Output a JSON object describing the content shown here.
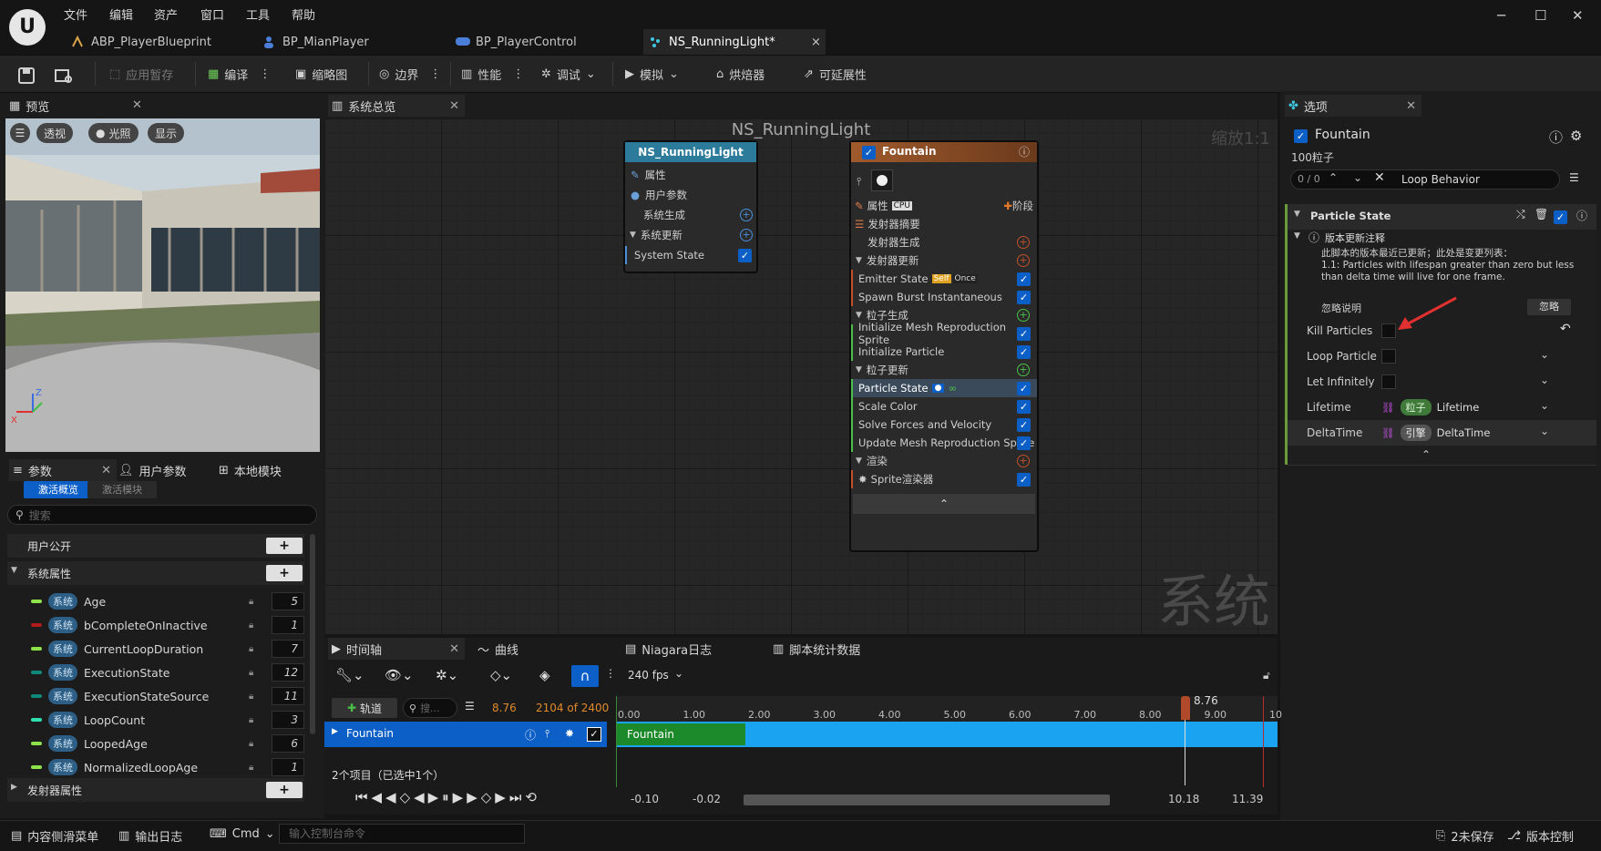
{
  "menu": [
    "文件",
    "编辑",
    "资产",
    "窗口",
    "工具",
    "帮助"
  ],
  "doc_tabs": [
    {
      "label": "ABP_PlayerBlueprint"
    },
    {
      "label": "BP_MianPlayer"
    },
    {
      "label": "BP_PlayerControl"
    },
    {
      "label": "NS_RunningLight*",
      "close": "×"
    }
  ],
  "toolbar": {
    "apply_pending": "应用暂存",
    "compile": "编译",
    "thumbnail": "缩略图",
    "bounds": "边界",
    "performance": "性能",
    "debug": "调试",
    "simulate": "模拟",
    "baker": "烘焙器",
    "scalability": "可延展性"
  },
  "preview": {
    "tab": "预览",
    "perspective": "透视",
    "lit": "光照",
    "show": "显示"
  },
  "params": {
    "tabs": [
      "参数",
      "用户参数",
      "本地模块"
    ],
    "subtabs": [
      "激活概览",
      "激活模块"
    ],
    "search_placeholder": "搜索",
    "user_exposed": "用户公开",
    "system_attrs": "系统属性",
    "emitter_attrs": "发射器属性",
    "badge": "系统",
    "rows": [
      {
        "name": "Age",
        "value": "5",
        "color": "#8ee24a"
      },
      {
        "name": "bCompleteOnInactive",
        "value": "1",
        "color": "#b11b1b"
      },
      {
        "name": "CurrentLoopDuration",
        "value": "7",
        "color": "#8ee24a"
      },
      {
        "name": "ExecutionState",
        "value": "12",
        "color": "#0f8a7a"
      },
      {
        "name": "ExecutionStateSource",
        "value": "11",
        "color": "#0f8a7a"
      },
      {
        "name": "LoopCount",
        "value": "3",
        "color": "#2ee0b0"
      },
      {
        "name": "LoopedAge",
        "value": "6",
        "color": "#8ee24a"
      },
      {
        "name": "NormalizedLoopAge",
        "value": "1",
        "color": "#8ee24a"
      }
    ]
  },
  "graph": {
    "tab": "系统总览",
    "title": "NS_RunningLight",
    "zoom": "缩放1:1",
    "watermark": "系统",
    "system_node": {
      "title": "NS_RunningLight",
      "rows": [
        "属性",
        "用户参数",
        "系统生成",
        "系统更新",
        "System State"
      ]
    },
    "emitter_node": {
      "title": "Fountain",
      "props": "属性",
      "cpu": "CPU",
      "stage": "阶段",
      "summary": "发射器摘要",
      "emitter_spawn": "发射器生成",
      "emitter_update": "发射器更新",
      "emitter_state": "Emitter State",
      "self": "Self",
      "once": "Once",
      "spawn_burst": "Spawn Burst Instantaneous",
      "particle_spawn": "粒子生成",
      "init_mesh": "Initialize Mesh Reproduction Sprite",
      "init_particle": "Initialize Particle",
      "particle_update": "粒子更新",
      "particle_state": "Particle State",
      "scale_color": "Scale Color",
      "solve_forces": "Solve Forces and Velocity",
      "update_mesh": "Update Mesh Reproduction Sprite",
      "render": "渲染",
      "sprite_renderer": "Sprite渲染器"
    }
  },
  "details": {
    "tab": "选项",
    "emitter": "Fountain",
    "particles": "100粒子",
    "counter": "0 / 0",
    "search_value": "Loop Behavior",
    "section": "Particle State",
    "note_title": "版本更新注释",
    "note_text": "此脚本的版本最近已更新；此处是变更列表：\n1.1: Particles with lifespan greater than zero but less than delta time will live for one frame.",
    "ignore_label": "忽略说明",
    "ignore_btn": "忽略",
    "props": [
      {
        "label": "Kill Particles"
      },
      {
        "label": "Loop Particle"
      },
      {
        "label": "Let Infinitely"
      }
    ],
    "lifetime": {
      "label": "Lifetime",
      "badge": "粒子",
      "value": "Lifetime"
    },
    "deltatime": {
      "label": "DeltaTime",
      "badge": "引擎",
      "value": "DeltaTime"
    }
  },
  "timeline": {
    "tabs": [
      "时间轴",
      "曲线",
      "Niagara日志",
      "脚本统计数据"
    ],
    "fps": "240 fps",
    "add_track": "轨道",
    "search_placeholder": "搜...",
    "current_time": "8.76",
    "frame_info": "2104 of 2400",
    "playhead_label": "8.76",
    "track": "Fountain",
    "bar_label": "Fountain",
    "ticks": [
      "0.00",
      "1.00",
      "2.00",
      "3.00",
      "4.00",
      "5.00",
      "6.00",
      "7.00",
      "8.00",
      "9.00",
      "10"
    ],
    "items": "2个项目（已选中1个）",
    "range_start": "-0.10",
    "range_start2": "-0.02",
    "range_end": "10.18",
    "range_end2": "11.39"
  },
  "statusbar": {
    "content_drawer": "内容侧滑菜单",
    "output_log": "输出日志",
    "cmd": "Cmd",
    "console_placeholder": "输入控制台命令",
    "unsaved": "2未保存",
    "source_control": "版本控制"
  }
}
